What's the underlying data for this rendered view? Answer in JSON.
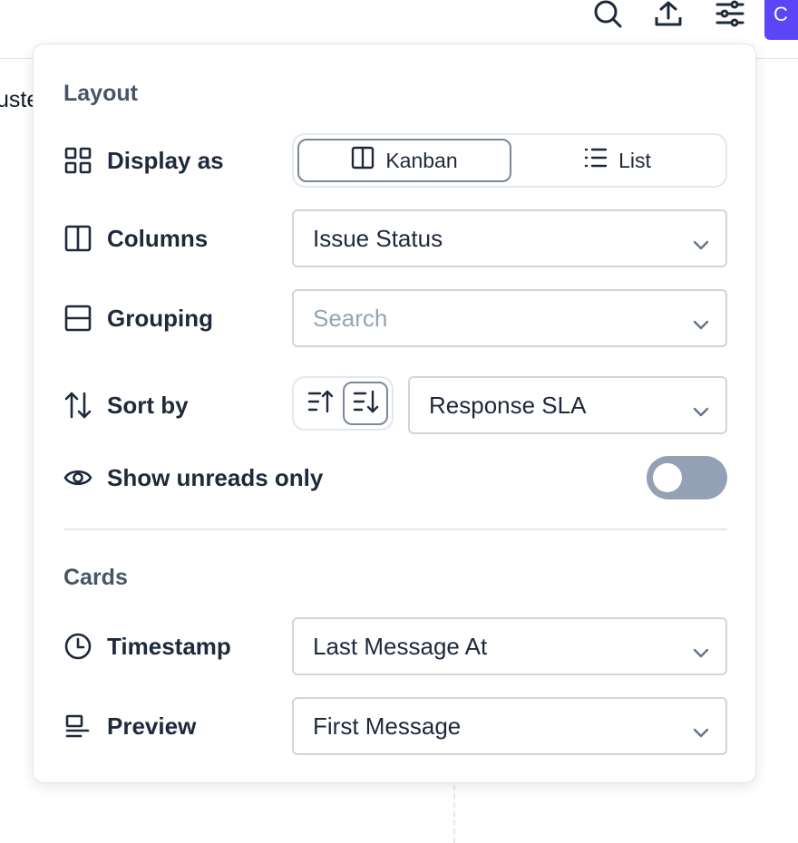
{
  "background": {
    "partial_label": "uste",
    "create_button_label": "C",
    "accent_color": "#5b45f6"
  },
  "toolbar": {
    "icons": [
      "search-icon",
      "upload-icon",
      "sliders-icon"
    ]
  },
  "layout_section": {
    "title": "Layout",
    "display_as": {
      "label": "Display as",
      "options": [
        "Kanban",
        "List"
      ],
      "selected": "Kanban"
    },
    "columns": {
      "label": "Columns",
      "value": "Issue Status"
    },
    "grouping": {
      "label": "Grouping",
      "placeholder": "Search"
    },
    "sort_by": {
      "label": "Sort by",
      "direction": "descending",
      "value": "Response SLA"
    },
    "show_unreads": {
      "label": "Show unreads only",
      "enabled": false
    }
  },
  "cards_section": {
    "title": "Cards",
    "timestamp": {
      "label": "Timestamp",
      "value": "Last Message At"
    },
    "preview": {
      "label": "Preview",
      "value": "First Message"
    }
  }
}
